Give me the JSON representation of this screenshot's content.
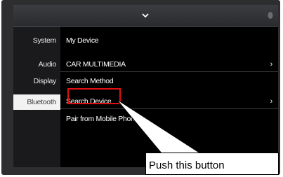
{
  "icons": {
    "collapse": "chevron-down-icon",
    "status": "bluetooth-status-icon",
    "row_arrow": "chevron-right-icon"
  },
  "sidebar": {
    "items": [
      {
        "label": "System",
        "active": false
      },
      {
        "label": "Audio",
        "active": false
      },
      {
        "label": "Display",
        "active": false
      },
      {
        "label": "Bluetooth",
        "active": true
      }
    ]
  },
  "main": {
    "rows": [
      {
        "label": "My Device",
        "arrow": ""
      },
      {
        "label": "CAR MULTIMEDIA",
        "arrow": "›"
      },
      {
        "label": "Search Method",
        "arrow": ""
      },
      {
        "label": "Search Device",
        "arrow": "›"
      },
      {
        "label": "Pair from Mobile Phone",
        "arrow": ""
      }
    ]
  },
  "annotation": {
    "text": "Push this button",
    "highlight_color": "#e01010"
  },
  "colors": {
    "screen_bg": "#000000",
    "active_tab_bg": "#f2f2f2",
    "bezel": "#2e2e31"
  }
}
